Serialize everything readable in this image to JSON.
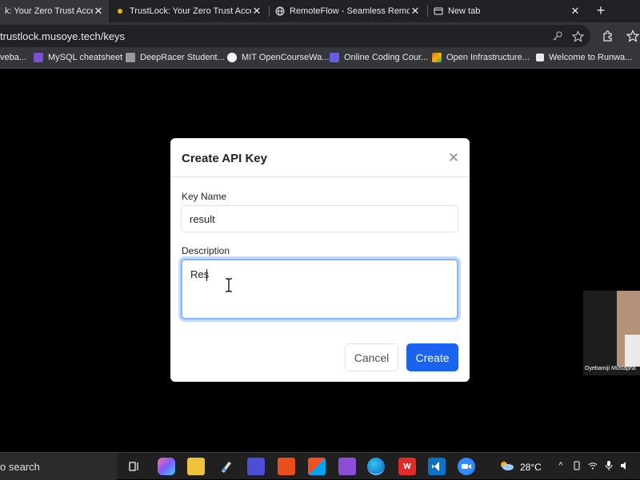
{
  "browser": {
    "tabs": [
      {
        "title": "k: Your Zero Trust Access"
      },
      {
        "title": "TrustLock: Your Zero Trust Access"
      },
      {
        "title": "RemoteFlow - Seamless Remote V"
      },
      {
        "title": "New tab"
      }
    ],
    "url": "trustlock.musoye.tech/keys",
    "bookmarks": [
      {
        "label": "veba...",
        "color": "#4a90d9"
      },
      {
        "label": "MySQL cheatsheet",
        "color": "#7b4fd1"
      },
      {
        "label": "DeepRacer Student...",
        "color": "#cfcfcf"
      },
      {
        "label": "MIT OpenCourseWa...",
        "color": "#ffffff"
      },
      {
        "label": "Online Coding Cour...",
        "color": "#6b5ce7"
      },
      {
        "label": "Open Infrastructure...",
        "color": "#e0642c"
      },
      {
        "label": "Welcome to Runwa...",
        "color": "#e8eaed"
      }
    ]
  },
  "modal": {
    "title": "Create API Key",
    "key_name_label": "Key Name",
    "key_name_value": "result",
    "description_label": "Description",
    "description_value": "Res",
    "cancel_label": "Cancel",
    "create_label": "Create",
    "primary_color": "#1a63f0"
  },
  "webcam": {
    "name": "Oyebamiji Mustapha"
  },
  "taskbar": {
    "search_text": "o search",
    "temperature": "28°C"
  }
}
